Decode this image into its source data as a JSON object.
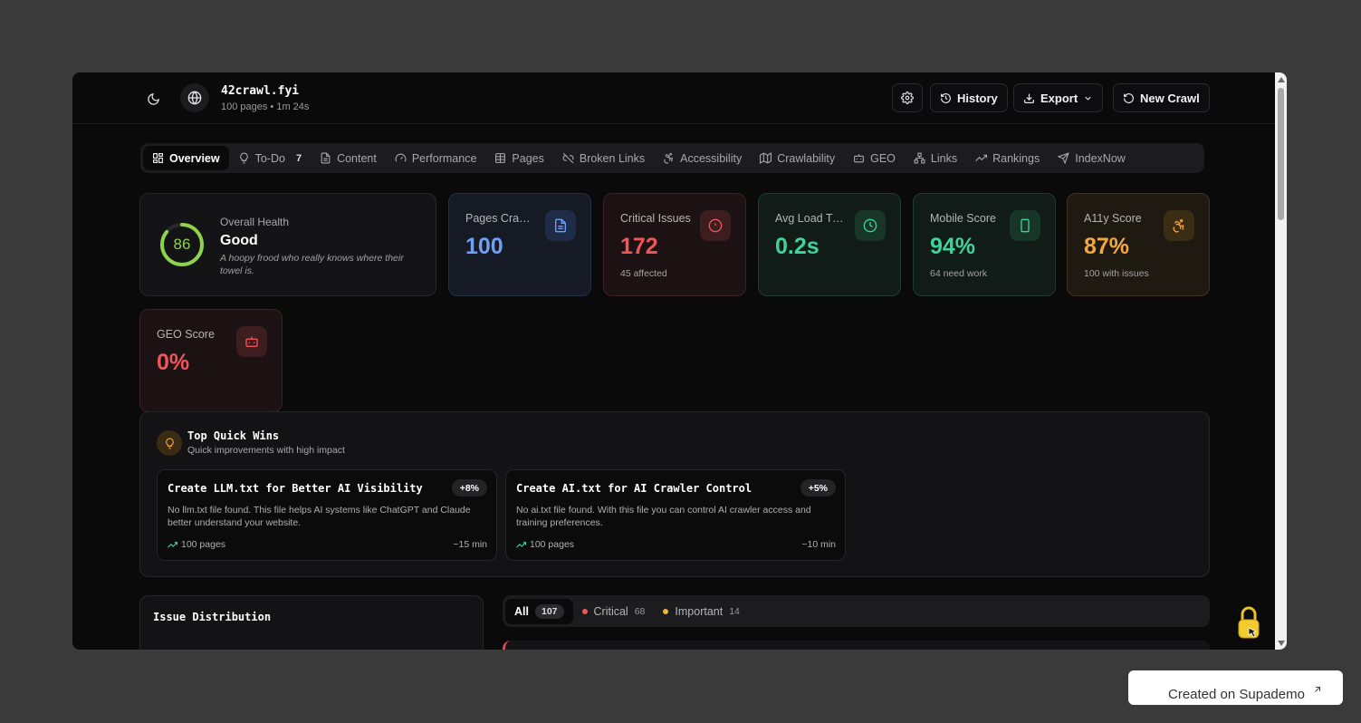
{
  "header": {
    "site_name": "42crawl.fyi",
    "site_meta": "100 pages • 1m 24s",
    "history_label": "History",
    "export_label": "Export",
    "new_crawl_label": "New Crawl"
  },
  "tabs": [
    {
      "label": "Overview",
      "icon": "grid-icon",
      "active": true
    },
    {
      "label": "To-Do",
      "icon": "lightbulb-icon",
      "count": "7"
    },
    {
      "label": "Content",
      "icon": "document-icon"
    },
    {
      "label": "Performance",
      "icon": "gauge-icon"
    },
    {
      "label": "Pages",
      "icon": "table-icon"
    },
    {
      "label": "Broken Links",
      "icon": "broken-link-icon"
    },
    {
      "label": "Accessibility",
      "icon": "accessibility-icon"
    },
    {
      "label": "Crawlability",
      "icon": "map-icon"
    },
    {
      "label": "GEO",
      "icon": "robot-icon"
    },
    {
      "label": "Links",
      "icon": "network-icon"
    },
    {
      "label": "Rankings",
      "icon": "trending-icon"
    },
    {
      "label": "IndexNow",
      "icon": "send-icon"
    }
  ],
  "health": {
    "score": "86",
    "score_fraction": 0.86,
    "label": "Overall Health",
    "rating": "Good",
    "quote": "A hoopy frood who really knows where their towel is."
  },
  "stats": {
    "pages": {
      "label": "Pages Crawled",
      "value": "100",
      "icon": "document-icon"
    },
    "critical": {
      "label": "Critical Issues",
      "value": "172",
      "sub": "45 affected",
      "icon": "alert-circle-icon"
    },
    "load": {
      "label": "Avg Load Time",
      "value": "0.2s",
      "icon": "clock-icon"
    },
    "mobile": {
      "label": "Mobile Score",
      "value": "94%",
      "sub": "64 need work",
      "icon": "phone-icon"
    },
    "a11y": {
      "label": "A11y Score",
      "value": "87%",
      "sub": "100 with issues",
      "icon": "accessibility-icon"
    },
    "geo": {
      "label": "GEO Score",
      "value": "0%",
      "icon": "robot-icon"
    }
  },
  "quick_wins": {
    "title": "Top Quick Wins",
    "subtitle": "Quick improvements with high impact",
    "items": [
      {
        "title": "Create LLM.txt for Better AI Visibility",
        "badge": "+8%",
        "desc": "No llm.txt file found. This file helps AI systems like ChatGPT and Claude better understand your website.",
        "pages": "100 pages",
        "time": "~15 min"
      },
      {
        "title": "Create AI.txt for AI Crawler Control",
        "badge": "+5%",
        "desc": "No ai.txt file found. With this file you can control AI crawler access and training preferences.",
        "pages": "100 pages",
        "time": "~10 min"
      }
    ]
  },
  "distribution": {
    "title": "Issue Distribution"
  },
  "filters": [
    {
      "label": "All",
      "count": "107",
      "active": true
    },
    {
      "label": "Critical",
      "count": "68",
      "color": "#f0555a"
    },
    {
      "label": "Important",
      "count": "14",
      "color": "#f4b23c"
    }
  ],
  "demo_badge": "Created on Supademo",
  "colors": {
    "accent_green": "#8ed14a",
    "critical": "#f0555a",
    "blue": "#6fa0f5",
    "teal": "#3dd39a",
    "amber": "#f4a640"
  }
}
